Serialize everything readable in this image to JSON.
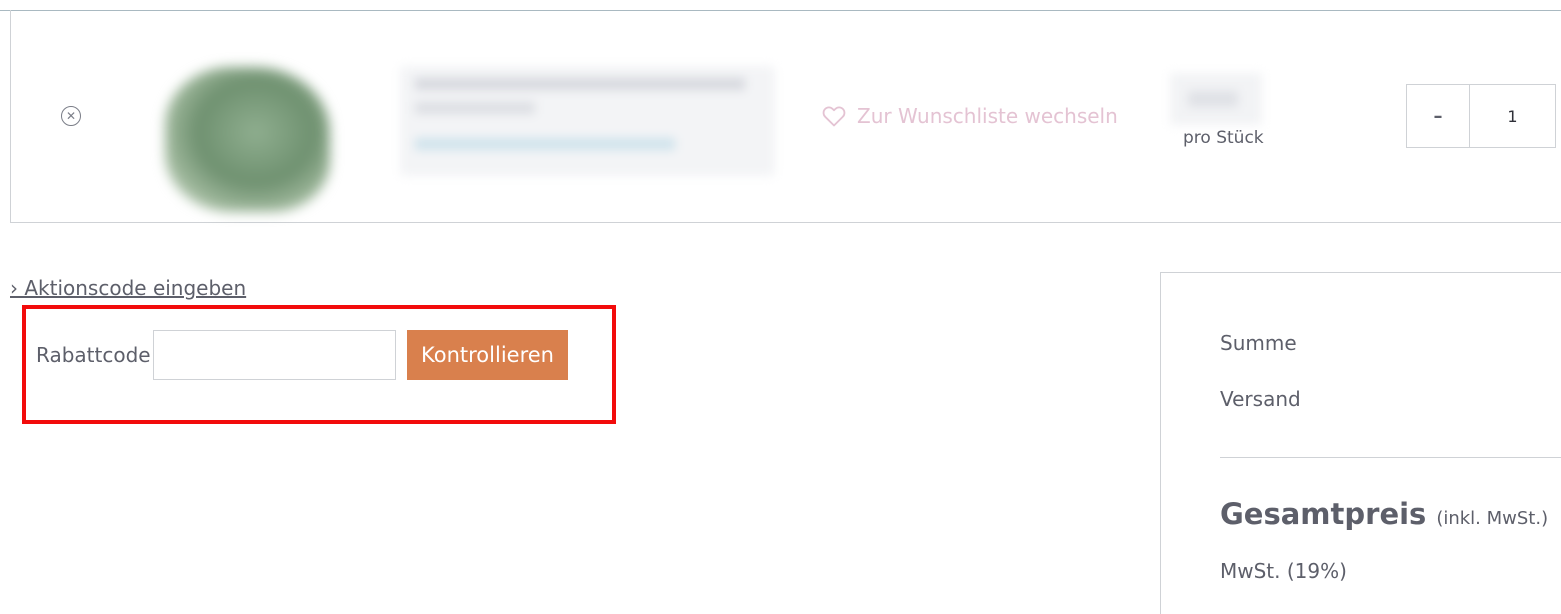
{
  "cart_item": {
    "remove_icon": "close-circle-icon",
    "wishlist_icon": "heart-icon",
    "wishlist_label": "Zur Wunschliste wechseln",
    "price_unit": "pro Stück",
    "quantity_minus": "–",
    "quantity": "1"
  },
  "promo": {
    "toggle_label": "› Aktionscode eingeben",
    "coupon_label": "Rabattcode",
    "coupon_value": "",
    "coupon_placeholder": "",
    "submit_label": "Kontrollieren"
  },
  "summary": {
    "subtotal_label": "Summe",
    "shipping_label": "Versand",
    "total_label": "Gesamtpreis",
    "total_note": "(inkl. MwSt.)",
    "tax_label": "MwSt. (19%)"
  },
  "colors": {
    "accent_button": "#d9804d",
    "wishlist_text": "#e4c3d3",
    "highlight_border": "#f20b0b",
    "text": "#5d5f6a",
    "border": "#cfd2d6"
  }
}
